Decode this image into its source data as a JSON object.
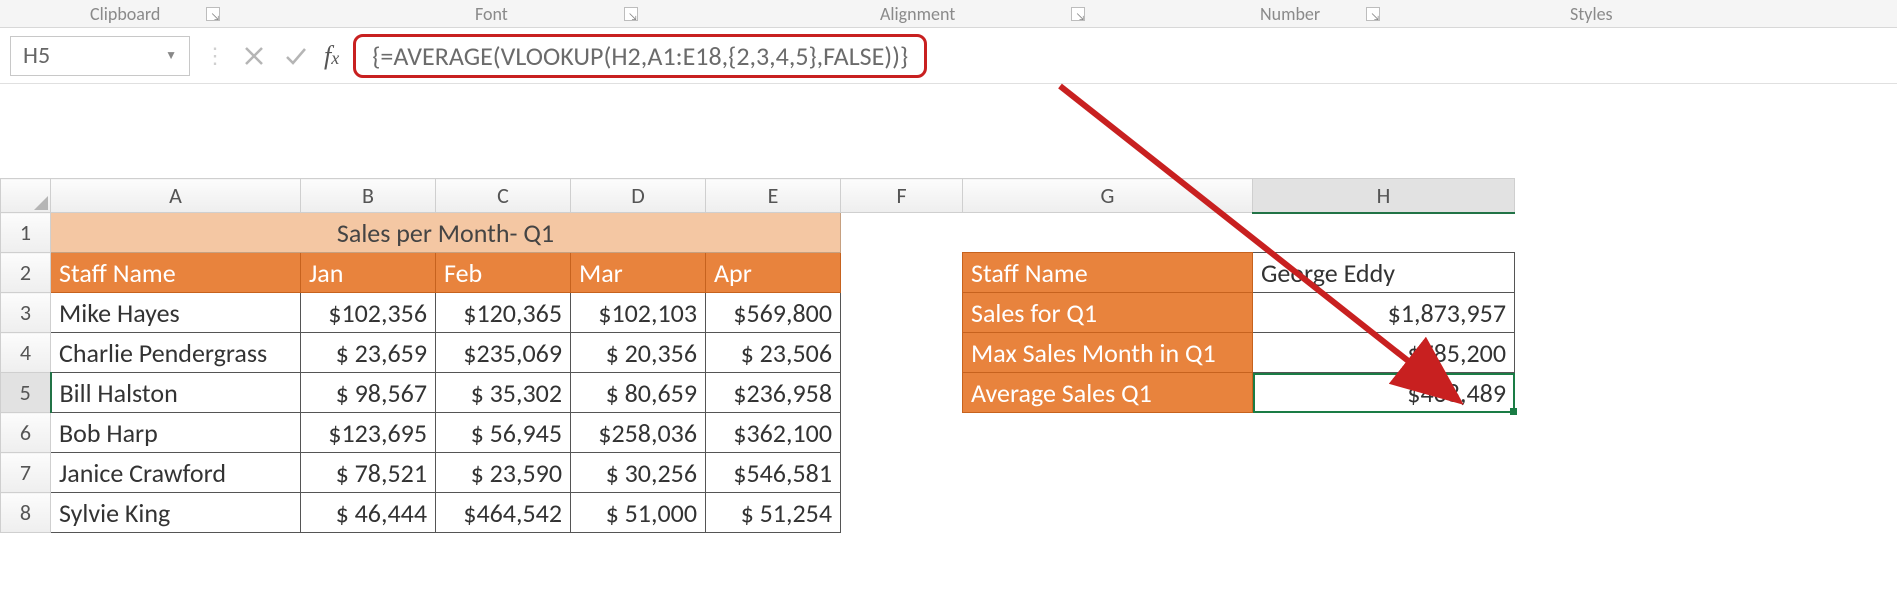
{
  "ribbon": {
    "groups": [
      "Clipboard",
      "Font",
      "Alignment",
      "Number",
      "Styles"
    ]
  },
  "name_box": "H5",
  "formula": "{=AVERAGE(VLOOKUP(H2,A1:E18,{2,3,4,5},FALSE))}",
  "columns": [
    "A",
    "B",
    "C",
    "D",
    "E",
    "F",
    "G",
    "H"
  ],
  "rows_visible": [
    1,
    2,
    3,
    4,
    5,
    6,
    7,
    8
  ],
  "table1": {
    "title": "Sales per Month- Q1",
    "headers": [
      "Staff Name",
      "Jan",
      "Feb",
      "Mar",
      "Apr"
    ],
    "rows": [
      {
        "name": "Mike Hayes",
        "jan": "$102,356",
        "feb": "$120,365",
        "mar": "$102,103",
        "apr": "$569,800"
      },
      {
        "name": "Charlie Pendergrass",
        "jan": "$ 23,659",
        "feb": "$235,069",
        "mar": "$ 20,356",
        "apr": "$ 23,506"
      },
      {
        "name": "Bill Halston",
        "jan": "$ 98,567",
        "feb": "$ 35,302",
        "mar": "$ 80,659",
        "apr": "$236,958"
      },
      {
        "name": "Bob Harp",
        "jan": "$123,695",
        "feb": "$ 56,945",
        "mar": "$258,036",
        "apr": "$362,100"
      },
      {
        "name": "Janice Crawford",
        "jan": "$ 78,521",
        "feb": "$ 23,590",
        "mar": "$ 30,256",
        "apr": "$546,581"
      },
      {
        "name": "Sylvie King",
        "jan": "$ 46,444",
        "feb": "$464,542",
        "mar": "$ 51,000",
        "apr": "$ 51,254"
      }
    ]
  },
  "summary": {
    "rows": [
      {
        "label": "Staff Name",
        "value": "George Eddy"
      },
      {
        "label": "Sales for Q1",
        "value": "1,873,957",
        "currency": "$"
      },
      {
        "label": "Max Sales Month in Q1",
        "value": "785,200",
        "currency": "$"
      },
      {
        "label": "Average Sales Q1",
        "value": "468,489",
        "currency": "$"
      }
    ]
  }
}
